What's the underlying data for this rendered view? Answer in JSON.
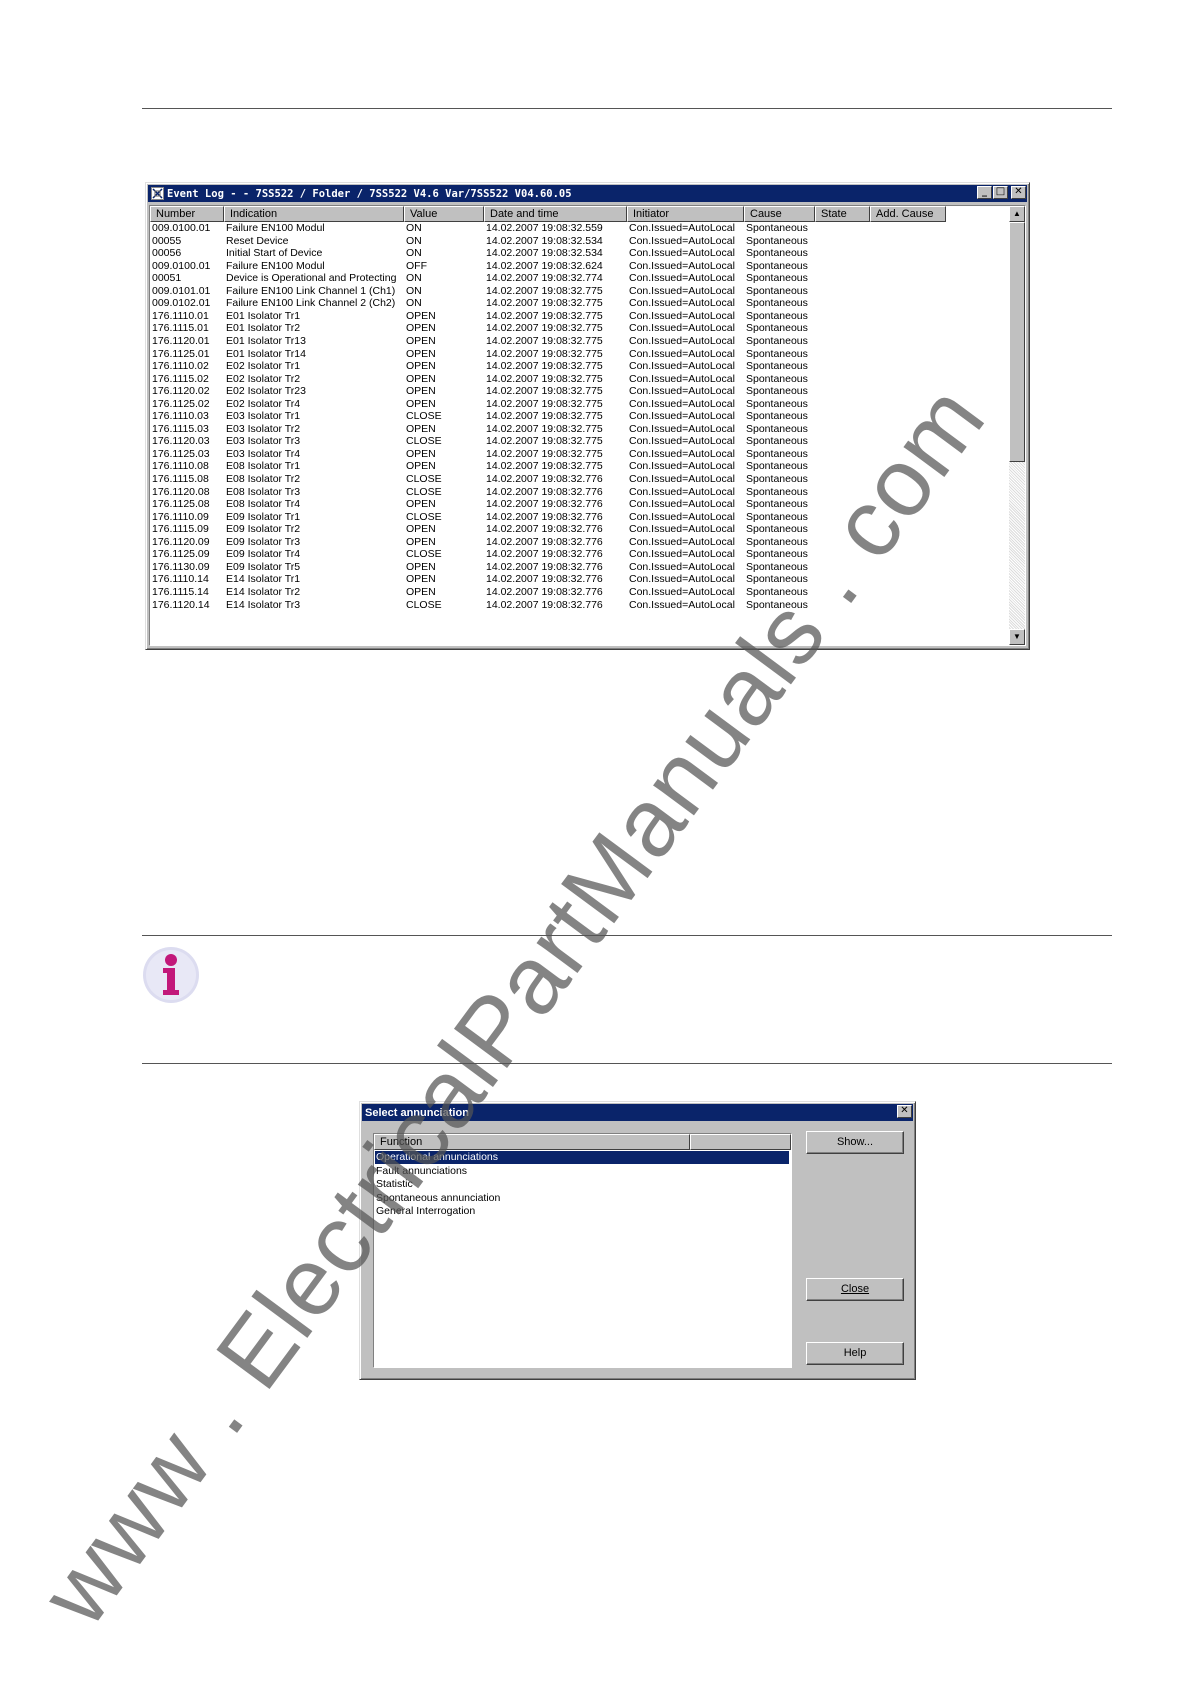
{
  "event_log": {
    "title": "Event Log - - 7SS522 / Folder / 7SS522 V4.6 Var/7SS522 V04.60.05",
    "columns": [
      "Number",
      "Indication",
      "Value",
      "Date and time",
      "Initiator",
      "Cause",
      "State",
      "Add. Cause"
    ],
    "rows": [
      [
        "009.0100.01",
        "Failure EN100 Modul",
        "ON",
        "14.02.2007  19:08:32.559",
        "Con.Issued=AutoLocal",
        "Spontaneous"
      ],
      [
        "00055",
        "Reset Device",
        "ON",
        "14.02.2007  19:08:32.534",
        "Con.Issued=AutoLocal",
        "Spontaneous"
      ],
      [
        "00056",
        "Initial Start of Device",
        "ON",
        "14.02.2007  19:08:32.534",
        "Con.Issued=AutoLocal",
        "Spontaneous"
      ],
      [
        "009.0100.01",
        "Failure EN100 Modul",
        "OFF",
        "14.02.2007  19:08:32.624",
        "Con.Issued=AutoLocal",
        "Spontaneous"
      ],
      [
        "00051",
        "Device is Operational and Protecting",
        "ON",
        "14.02.2007  19:08:32.774",
        "Con.Issued=AutoLocal",
        "Spontaneous"
      ],
      [
        "009.0101.01",
        "Failure EN100 Link Channel 1 (Ch1)",
        "ON",
        "14.02.2007  19:08:32.775",
        "Con.Issued=AutoLocal",
        "Spontaneous"
      ],
      [
        "009.0102.01",
        "Failure EN100 Link Channel 2 (Ch2)",
        "ON",
        "14.02.2007  19:08:32.775",
        "Con.Issued=AutoLocal",
        "Spontaneous"
      ],
      [
        "176.1110.01",
        "E01 Isolator Tr1",
        "OPEN",
        "14.02.2007  19:08:32.775",
        "Con.Issued=AutoLocal",
        "Spontaneous"
      ],
      [
        "176.1115.01",
        "E01 Isolator Tr2",
        "OPEN",
        "14.02.2007  19:08:32.775",
        "Con.Issued=AutoLocal",
        "Spontaneous"
      ],
      [
        "176.1120.01",
        "E01 Isolator Tr13",
        "OPEN",
        "14.02.2007  19:08:32.775",
        "Con.Issued=AutoLocal",
        "Spontaneous"
      ],
      [
        "176.1125.01",
        "E01 Isolator Tr14",
        "OPEN",
        "14.02.2007  19:08:32.775",
        "Con.Issued=AutoLocal",
        "Spontaneous"
      ],
      [
        "176.1110.02",
        "E02 Isolator Tr1",
        "OPEN",
        "14.02.2007  19:08:32.775",
        "Con.Issued=AutoLocal",
        "Spontaneous"
      ],
      [
        "176.1115.02",
        "E02 Isolator Tr2",
        "OPEN",
        "14.02.2007  19:08:32.775",
        "Con.Issued=AutoLocal",
        "Spontaneous"
      ],
      [
        "176.1120.02",
        "E02 Isolator Tr23",
        "OPEN",
        "14.02.2007  19:08:32.775",
        "Con.Issued=AutoLocal",
        "Spontaneous"
      ],
      [
        "176.1125.02",
        "E02 Isolator Tr4",
        "OPEN",
        "14.02.2007  19:08:32.775",
        "Con.Issued=AutoLocal",
        "Spontaneous"
      ],
      [
        "176.1110.03",
        "E03 Isolator Tr1",
        "CLOSE",
        "14.02.2007  19:08:32.775",
        "Con.Issued=AutoLocal",
        "Spontaneous"
      ],
      [
        "176.1115.03",
        "E03 Isolator Tr2",
        "OPEN",
        "14.02.2007  19:08:32.775",
        "Con.Issued=AutoLocal",
        "Spontaneous"
      ],
      [
        "176.1120.03",
        "E03 Isolator Tr3",
        "CLOSE",
        "14.02.2007  19:08:32.775",
        "Con.Issued=AutoLocal",
        "Spontaneous"
      ],
      [
        "176.1125.03",
        "E03 Isolator Tr4",
        "OPEN",
        "14.02.2007  19:08:32.775",
        "Con.Issued=AutoLocal",
        "Spontaneous"
      ],
      [
        "176.1110.08",
        "E08 Isolator Tr1",
        "OPEN",
        "14.02.2007  19:08:32.775",
        "Con.Issued=AutoLocal",
        "Spontaneous"
      ],
      [
        "176.1115.08",
        "E08 Isolator Tr2",
        "CLOSE",
        "14.02.2007  19:08:32.776",
        "Con.Issued=AutoLocal",
        "Spontaneous"
      ],
      [
        "176.1120.08",
        "E08 Isolator Tr3",
        "CLOSE",
        "14.02.2007  19:08:32.776",
        "Con.Issued=AutoLocal",
        "Spontaneous"
      ],
      [
        "176.1125.08",
        "E08 Isolator Tr4",
        "OPEN",
        "14.02.2007  19:08:32.776",
        "Con.Issued=AutoLocal",
        "Spontaneous"
      ],
      [
        "176.1110.09",
        "E09 Isolator Tr1",
        "CLOSE",
        "14.02.2007  19:08:32.776",
        "Con.Issued=AutoLocal",
        "Spontaneous"
      ],
      [
        "176.1115.09",
        "E09 Isolator Tr2",
        "OPEN",
        "14.02.2007  19:08:32.776",
        "Con.Issued=AutoLocal",
        "Spontaneous"
      ],
      [
        "176.1120.09",
        "E09 Isolator Tr3",
        "OPEN",
        "14.02.2007  19:08:32.776",
        "Con.Issued=AutoLocal",
        "Spontaneous"
      ],
      [
        "176.1125.09",
        "E09 Isolator Tr4",
        "CLOSE",
        "14.02.2007  19:08:32.776",
        "Con.Issued=AutoLocal",
        "Spontaneous"
      ],
      [
        "176.1130.09",
        "E09 Isolator Tr5",
        "OPEN",
        "14.02.2007  19:08:32.776",
        "Con.Issued=AutoLocal",
        "Spontaneous"
      ],
      [
        "176.1110.14",
        "E14 Isolator Tr1",
        "OPEN",
        "14.02.2007  19:08:32.776",
        "Con.Issued=AutoLocal",
        "Spontaneous"
      ],
      [
        "176.1115.14",
        "E14 Isolator Tr2",
        "OPEN",
        "14.02.2007  19:08:32.776",
        "Con.Issued=AutoLocal",
        "Spontaneous"
      ],
      [
        "176.1120.14",
        "E14 Isolator Tr3",
        "CLOSE",
        "14.02.2007  19:08:32.776",
        "Con.Issued=AutoLocal",
        "Spontaneous"
      ]
    ]
  },
  "select_annunciation": {
    "title": "Select annunciation",
    "column_header": "Function",
    "items": [
      "Operational annunciations",
      "Fault annunciations",
      "Statistic",
      "Spontaneous annunciation",
      "General Interrogation"
    ],
    "selected_index": 0,
    "buttons": {
      "show": "Show...",
      "close": "Close",
      "help": "Help"
    }
  },
  "watermark": "www . ElectricalPartManuals . com",
  "icons": {
    "info": "info-icon",
    "window_app": "event-log-app-icon"
  },
  "colors": {
    "titlebar": "#0a246a",
    "selection": "#0a246a",
    "info_icon": "#c2187a"
  }
}
